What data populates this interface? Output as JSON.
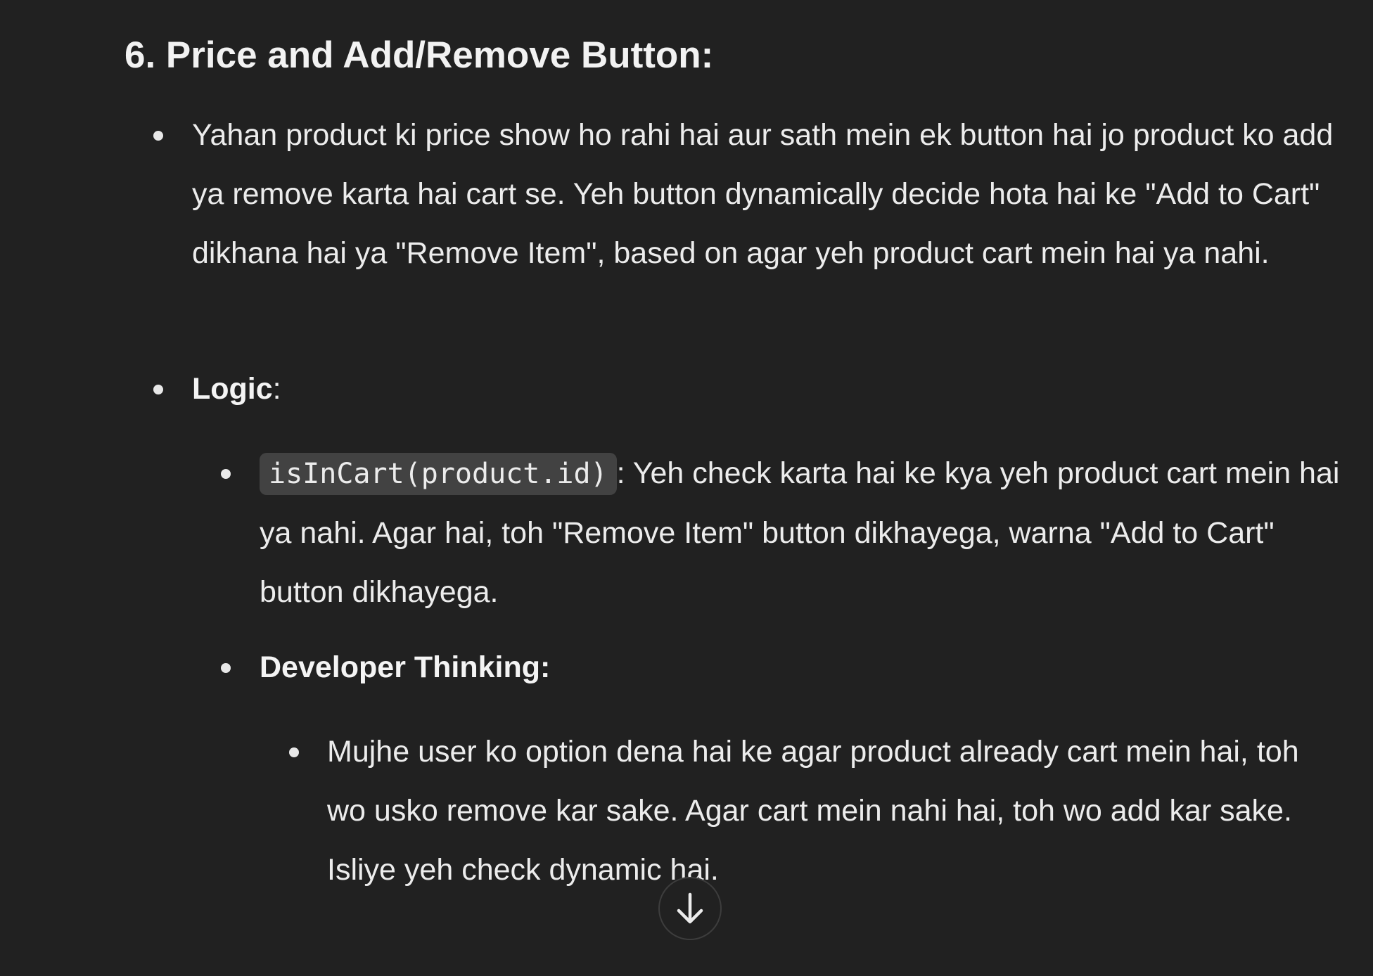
{
  "section": {
    "heading": "6. Price and Add/Remove Button:",
    "description": "Yahan product ki price show ho rahi hai aur sath mein ek button hai jo product ko add ya remove karta hai cart se. Yeh button dynamically decide hota hai ke \"Add to Cart\" dikhana hai ya \"Remove Item\", based on agar yeh product cart mein hai ya nahi.",
    "logic_label": "Logic",
    "logic_colon": ":",
    "logic_item": {
      "code": "isInCart(product.id)",
      "text": ": Yeh check karta hai ke kya yeh product cart mein hai ya nahi. Agar hai, toh \"Remove Item\" button dikhayega, warna \"Add to Cart\" button dikhayega."
    },
    "developer_label": "Developer Thinking:",
    "developer_item": "Mujhe user ko option dena hai ke agar product already cart mein hai, toh wo usko remove kar sake. Agar cart mein nahi hai, toh wo add kar sake. Isliye yeh check dynamic hai."
  },
  "controls": {
    "scroll_down_icon": "arrow-down-icon"
  }
}
